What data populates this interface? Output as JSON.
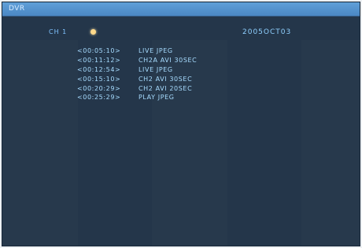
{
  "window": {
    "title": "DVR"
  },
  "header": {
    "channel": "CH 1",
    "date": "2005OCT03"
  },
  "log_entries": [
    {
      "time": "<00:05:10>",
      "event": "LIVE JPEG"
    },
    {
      "time": "<00:11:12>",
      "event": "CH2A AVI 30SEC"
    },
    {
      "time": "<00:12:54>",
      "event": "LIVE JPEG"
    },
    {
      "time": "<00:15:10>",
      "event": "CH2 AVI 30SEC"
    },
    {
      "time": "<00:20:29>",
      "event": "CH2 AVI 20SEC"
    },
    {
      "time": "<00:25:29>",
      "event": "PLAY JPEG"
    }
  ],
  "colors": {
    "background": "#24364a",
    "title_bar": "#4b88c4",
    "text": "#a7dcff",
    "record_indicator": "#ffd98a"
  },
  "icons": {
    "record_indicator": "record-dot-icon"
  }
}
